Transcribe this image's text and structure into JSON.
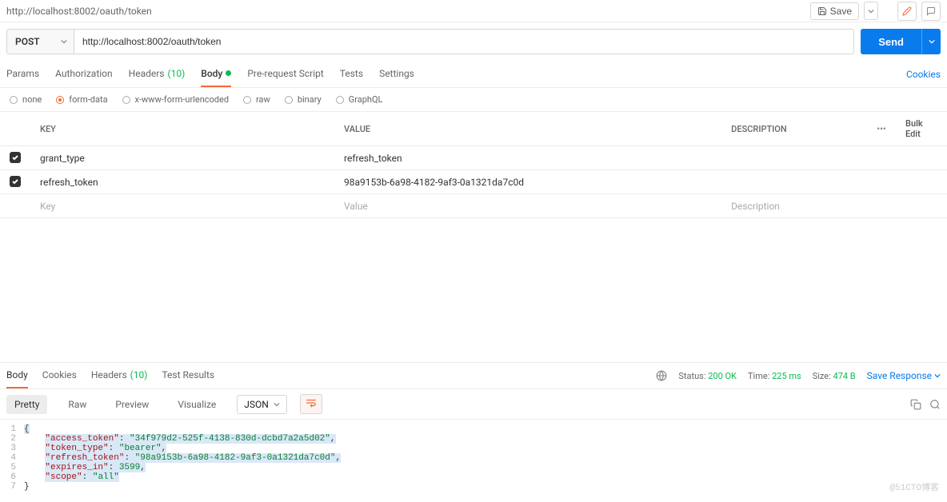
{
  "topbar": {
    "title": "http://localhost:8002/oauth/token",
    "save_label": "Save"
  },
  "request": {
    "method": "POST",
    "url": "http://localhost:8002/oauth/token",
    "send_label": "Send"
  },
  "req_tabs": {
    "params": "Params",
    "auth": "Authorization",
    "headers": "Headers",
    "headers_count": "(10)",
    "body": "Body",
    "prs": "Pre-request Script",
    "tests": "Tests",
    "settings": "Settings",
    "cookies": "Cookies"
  },
  "body_types": {
    "none": "none",
    "formdata": "form-data",
    "xwww": "x-www-form-urlencoded",
    "raw": "raw",
    "binary": "binary",
    "graphql": "GraphQL"
  },
  "table": {
    "hdr_key": "KEY",
    "hdr_val": "VALUE",
    "hdr_desc": "DESCRIPTION",
    "bulk": "Bulk Edit",
    "dots": "•••",
    "rows": [
      {
        "key": "grant_type",
        "value": "refresh_token"
      },
      {
        "key": "refresh_token",
        "value": "98a9153b-6a98-4182-9af3-0a1321da7c0d"
      }
    ],
    "ph_key": "Key",
    "ph_val": "Value",
    "ph_desc": "Description"
  },
  "resp_tabs": {
    "body": "Body",
    "cookies": "Cookies",
    "headers": "Headers",
    "headers_count": "(10)",
    "tests": "Test Results"
  },
  "status": {
    "status_lbl": "Status:",
    "status_val": "200 OK",
    "time_lbl": "Time:",
    "time_val": "225 ms",
    "size_lbl": "Size:",
    "size_val": "474 B",
    "save_response": "Save Response"
  },
  "view": {
    "pretty": "Pretty",
    "raw": "Raw",
    "preview": "Preview",
    "visualize": "Visualize",
    "format": "JSON"
  },
  "response_body": {
    "access_token": "34f979d2-525f-4138-830d-dcbd7a2a5d02",
    "token_type": "bearer",
    "refresh_token": "98a9153b-6a98-4182-9af3-0a1321da7c0d",
    "expires_in": 3599,
    "scope": "all"
  },
  "watermark": "@51CTO博客"
}
